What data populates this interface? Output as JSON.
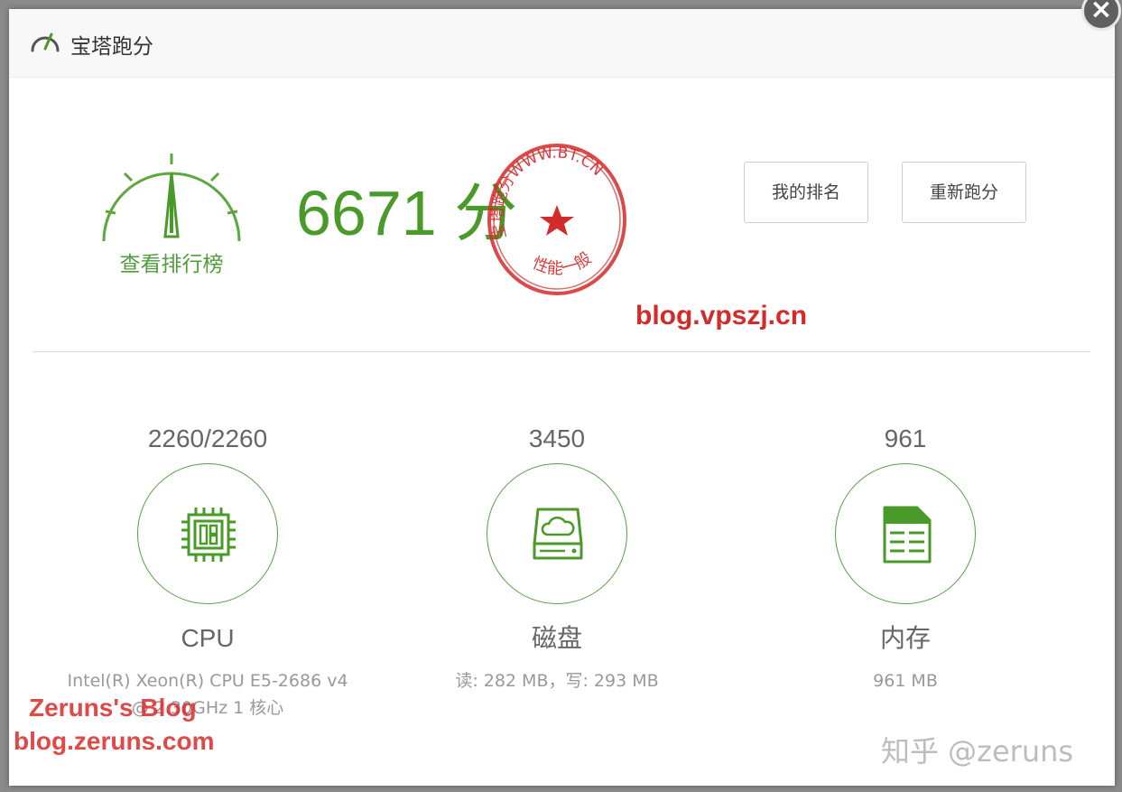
{
  "window": {
    "title": "宝塔跑分",
    "title_icon": "speedometer-icon",
    "close_label": "×"
  },
  "score": {
    "value": "6671 分",
    "ranking_link": "查看排行榜",
    "gauge_icon": "speedometer-gauge-icon"
  },
  "stamp": {
    "top_text": "宝塔跑分WWW.BT.CN",
    "bottom_text": "性能一般"
  },
  "watermarks": {
    "site": "blog.vpszj.cn",
    "blog_name": "Zeruns's Blog",
    "blog_url": "blog.zeruns.com",
    "zhihu": "知乎 @zeruns"
  },
  "buttons": {
    "my_rank": "我的排名",
    "rerun": "重新跑分"
  },
  "metrics": [
    {
      "value": "2260/2260",
      "label": "CPU",
      "detail": "Intel(R) Xeon(R) CPU E5-2686 v4 @ 2.30GHz 1 核心",
      "icon": "cpu-chip-icon"
    },
    {
      "value": "3450",
      "label": "磁盘",
      "detail": "读: 282 MB，写: 293 MB",
      "icon": "cloud-disk-icon"
    },
    {
      "value": "961",
      "label": "内存",
      "detail": "961 MB",
      "icon": "memory-document-icon"
    }
  ],
  "colors": {
    "accent_green": "#4a9a2a",
    "stamp_red": "#d42a2a"
  }
}
